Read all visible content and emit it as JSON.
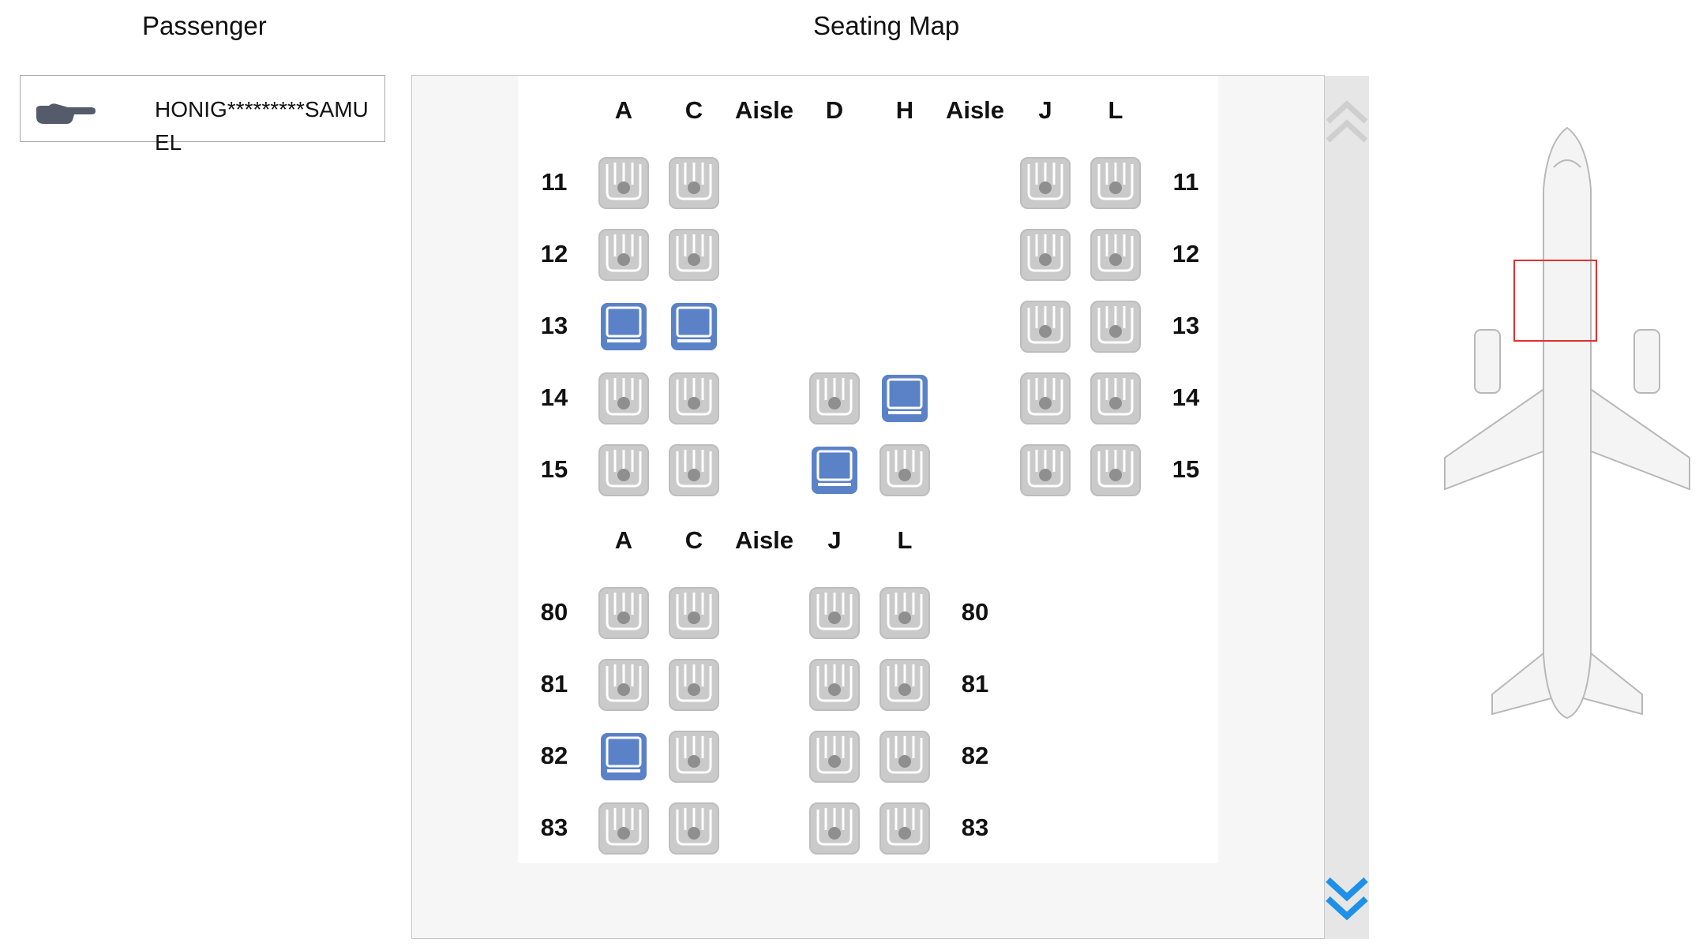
{
  "headings": {
    "passenger": "Passenger",
    "seating_map": "Seating Map"
  },
  "passenger": {
    "name": "HONIG*********SAMUEL",
    "pointer_icon": "pointing-hand-icon"
  },
  "colors": {
    "available": "#5b82c6",
    "occupied": "#c9c9c9",
    "highlight_box": "#e03030",
    "scroll_arrow_down": "#1e90e8",
    "scroll_arrow_up": "#cfcfcf"
  },
  "upper_cabin": {
    "columns": [
      "A",
      "C",
      "Aisle",
      "D",
      "H",
      "Aisle",
      "J",
      "L"
    ],
    "rows": [
      {
        "number": "11",
        "seats": {
          "A": "occupied",
          "C": "occupied",
          "J": "occupied",
          "L": "occupied"
        }
      },
      {
        "number": "12",
        "seats": {
          "A": "occupied",
          "C": "occupied",
          "J": "occupied",
          "L": "occupied"
        }
      },
      {
        "number": "13",
        "seats": {
          "A": "available",
          "C": "available",
          "J": "occupied",
          "L": "occupied"
        }
      },
      {
        "number": "14",
        "seats": {
          "A": "occupied",
          "C": "occupied",
          "D": "occupied",
          "H": "available",
          "J": "occupied",
          "L": "occupied"
        }
      },
      {
        "number": "15",
        "seats": {
          "A": "occupied",
          "C": "occupied",
          "D": "available",
          "H": "occupied",
          "J": "occupied",
          "L": "occupied"
        }
      }
    ]
  },
  "lower_cabin": {
    "columns": [
      "A",
      "C",
      "Aisle",
      "J",
      "L"
    ],
    "rows": [
      {
        "number": "80",
        "seats": {
          "A": "occupied",
          "C": "occupied",
          "J": "occupied",
          "L": "occupied"
        }
      },
      {
        "number": "81",
        "seats": {
          "A": "occupied",
          "C": "occupied",
          "J": "occupied",
          "L": "occupied"
        }
      },
      {
        "number": "82",
        "seats": {
          "A": "available",
          "C": "occupied",
          "J": "occupied",
          "L": "occupied"
        }
      },
      {
        "number": "83",
        "seats": {
          "A": "occupied",
          "C": "occupied",
          "J": "occupied",
          "L": "occupied"
        }
      }
    ]
  },
  "icons": {
    "scroll_up": "chevron-up-icon",
    "scroll_down": "chevron-down-icon",
    "plane": "airplane-overview-icon"
  }
}
